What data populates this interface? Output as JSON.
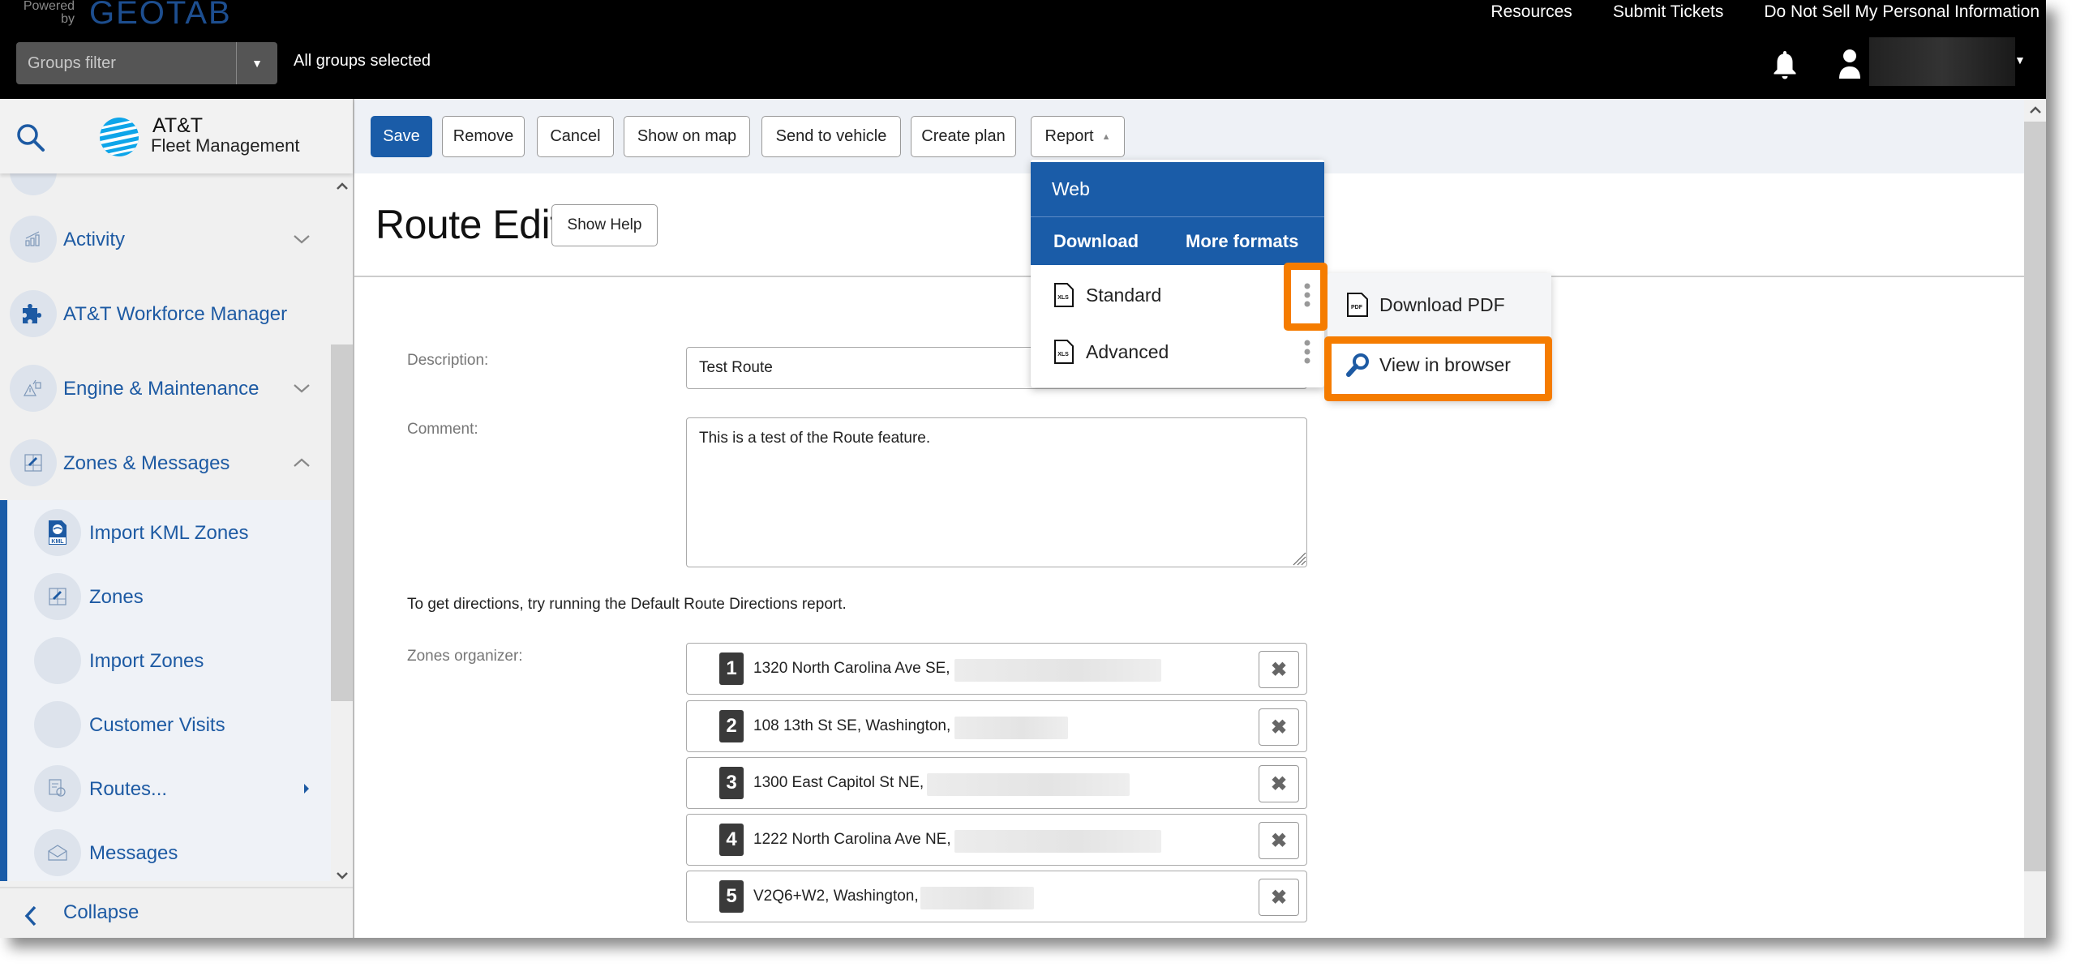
{
  "header": {
    "powered_by": "Powered by",
    "brand": "GEOTAB",
    "groups_filter": {
      "placeholder": "Groups filter",
      "status": "All groups selected"
    },
    "links": [
      "Resources",
      "Submit Tickets",
      "Do Not Sell My Personal Information"
    ],
    "icons": {
      "notifications": "bell-icon",
      "user": "user-icon",
      "user_menu": "caret-down-icon"
    }
  },
  "sidebar": {
    "logo_title": "AT&T",
    "logo_subtitle": "Fleet Management",
    "items": [
      {
        "label": "Activity",
        "icon": "activity-chart-icon",
        "state": "collapsed"
      },
      {
        "label": "AT&T Workforce Manager",
        "icon": "puzzle-icon"
      },
      {
        "label": "Engine & Maintenance",
        "icon": "engine-warning-icon",
        "state": "collapsed"
      },
      {
        "label": "Zones & Messages",
        "icon": "zone-edit-icon",
        "state": "expanded"
      }
    ],
    "subitems": [
      {
        "label": "Import KML Zones",
        "icon": "kml-file-icon"
      },
      {
        "label": "Zones",
        "icon": "zone-edit-icon"
      },
      {
        "label": "Import Zones",
        "icon": ""
      },
      {
        "label": "Customer Visits",
        "icon": ""
      },
      {
        "label": "Routes...",
        "icon": "route-icon",
        "has_submenu": true
      },
      {
        "label": "Messages",
        "icon": "envelope-icon"
      }
    ],
    "collapse_label": "Collapse"
  },
  "toolbar": {
    "save": "Save",
    "remove": "Remove",
    "cancel": "Cancel",
    "show_on_map": "Show on map",
    "send_to_vehicle": "Send to vehicle",
    "create_plan": "Create plan",
    "report": "Report"
  },
  "page": {
    "title": "Route Edit",
    "show_help": "Show Help"
  },
  "form": {
    "description_label": "Description:",
    "description_value": "Test Route",
    "comment_label": "Comment:",
    "comment_value": "This is a test of the Route feature.",
    "directions_note": "To get directions, try running the Default Route Directions report.",
    "zones_label": "Zones organizer:",
    "zones": [
      {
        "index": "1",
        "address": "1320 North Carolina Ave SE,"
      },
      {
        "index": "2",
        "address": "108 13th St SE, Washington,"
      },
      {
        "index": "3",
        "address": "1300 East Capitol St NE,"
      },
      {
        "index": "4",
        "address": "1222 North Carolina Ave NE,"
      },
      {
        "index": "5",
        "address": "V2Q6+W2, Washington,"
      }
    ],
    "remove_glyph": "✖"
  },
  "report_menu": {
    "web": "Web",
    "tabs": [
      "Download",
      "More formats"
    ],
    "rows": [
      {
        "label": "Standard",
        "icon": "xls-file-icon"
      },
      {
        "label": "Advanced",
        "icon": "xls-file-icon"
      }
    ]
  },
  "sub_menu": {
    "items": [
      {
        "label": "Download PDF",
        "icon": "pdf-file-icon"
      },
      {
        "label": "View in browser",
        "icon": "magnifier-icon",
        "highlighted": true
      }
    ]
  },
  "colors": {
    "brand_blue": "#1a5ca8",
    "highlight_orange": "#f57c00",
    "header_bg": "#000000",
    "toolbar_bg": "#eef1f6"
  }
}
